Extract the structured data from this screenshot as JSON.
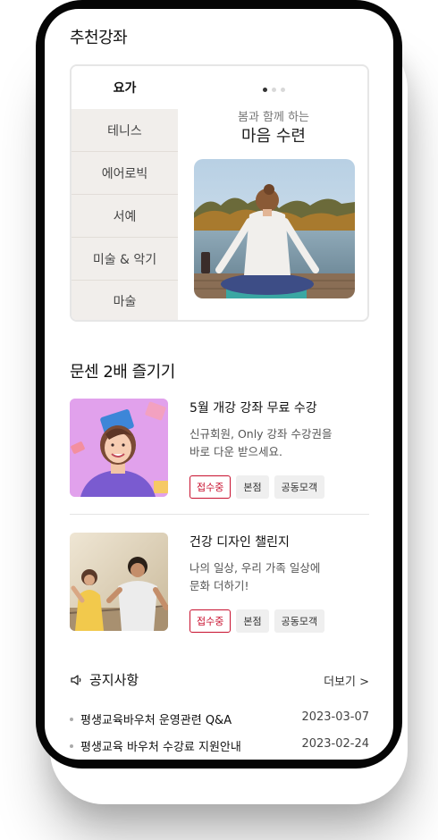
{
  "recommended": {
    "title": "추천강좌",
    "tabs": [
      "요가",
      "테니스",
      "에어로빅",
      "서예",
      "미술 & 악기",
      "마술"
    ],
    "subtitle": "봄과 함께 하는",
    "headline": "마음 수련",
    "image_icon": "yoga-photo"
  },
  "events": {
    "title": "문센 2배 즐기기",
    "items": [
      {
        "title": "5월 개강 강좌 무료 수강",
        "desc_line1": "신규회원, Only 강좌 수강권을",
        "desc_line2": "바로 다운 받으세요.",
        "tags": [
          "접수중",
          "본점",
          "공동모객"
        ],
        "image_icon": "coupon-girl-illustration"
      },
      {
        "title": "건강 디자인 챌린지",
        "desc_line1": "나의 일상, 우리 가족 일상에",
        "desc_line2": "문화 더하기!",
        "tags": [
          "접수중",
          "본점",
          "공동모객"
        ],
        "image_icon": "running-couple-photo"
      }
    ]
  },
  "notice": {
    "title": "공지사항",
    "more": "더보기 >",
    "items": [
      {
        "text": "평생교육바우처 운영관련 Q&A",
        "date": "2023-03-07"
      },
      {
        "text": "평생교육 바우처 수강료 지원안내",
        "date": "2023-02-24"
      }
    ]
  },
  "colors": {
    "accent_red": "#c8102e",
    "tab_bg": "#f1eeeb"
  }
}
